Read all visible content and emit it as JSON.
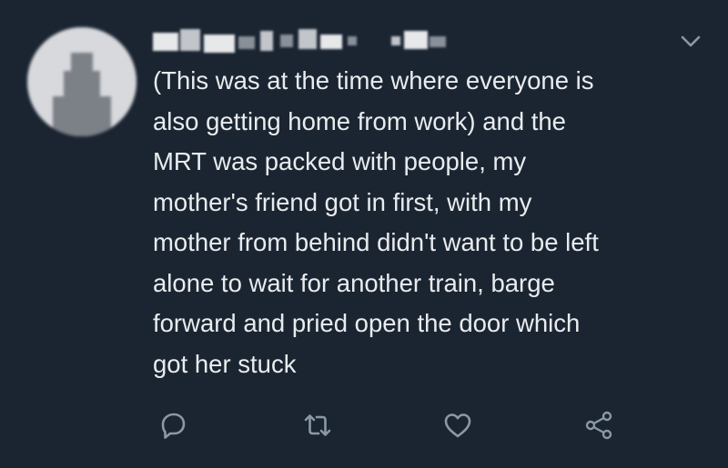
{
  "tweet": {
    "text": "(This was at the time where everyone is\nalso getting home from work) and the\nMRT was packed with people, my\nmother's friend got in first, with my\nmother from behind didn't want to be left\nalone to wait for another train, barge\nforward and pried open the door which\ngot her stuck"
  },
  "icons": {
    "menu": "chevron-down-icon",
    "reply": "reply-icon",
    "retweet": "retweet-icon",
    "like": "heart-icon",
    "share": "share-icon"
  },
  "colors": {
    "background": "#1b2532",
    "text": "#e9ecee",
    "icon": "#8b98a5"
  }
}
